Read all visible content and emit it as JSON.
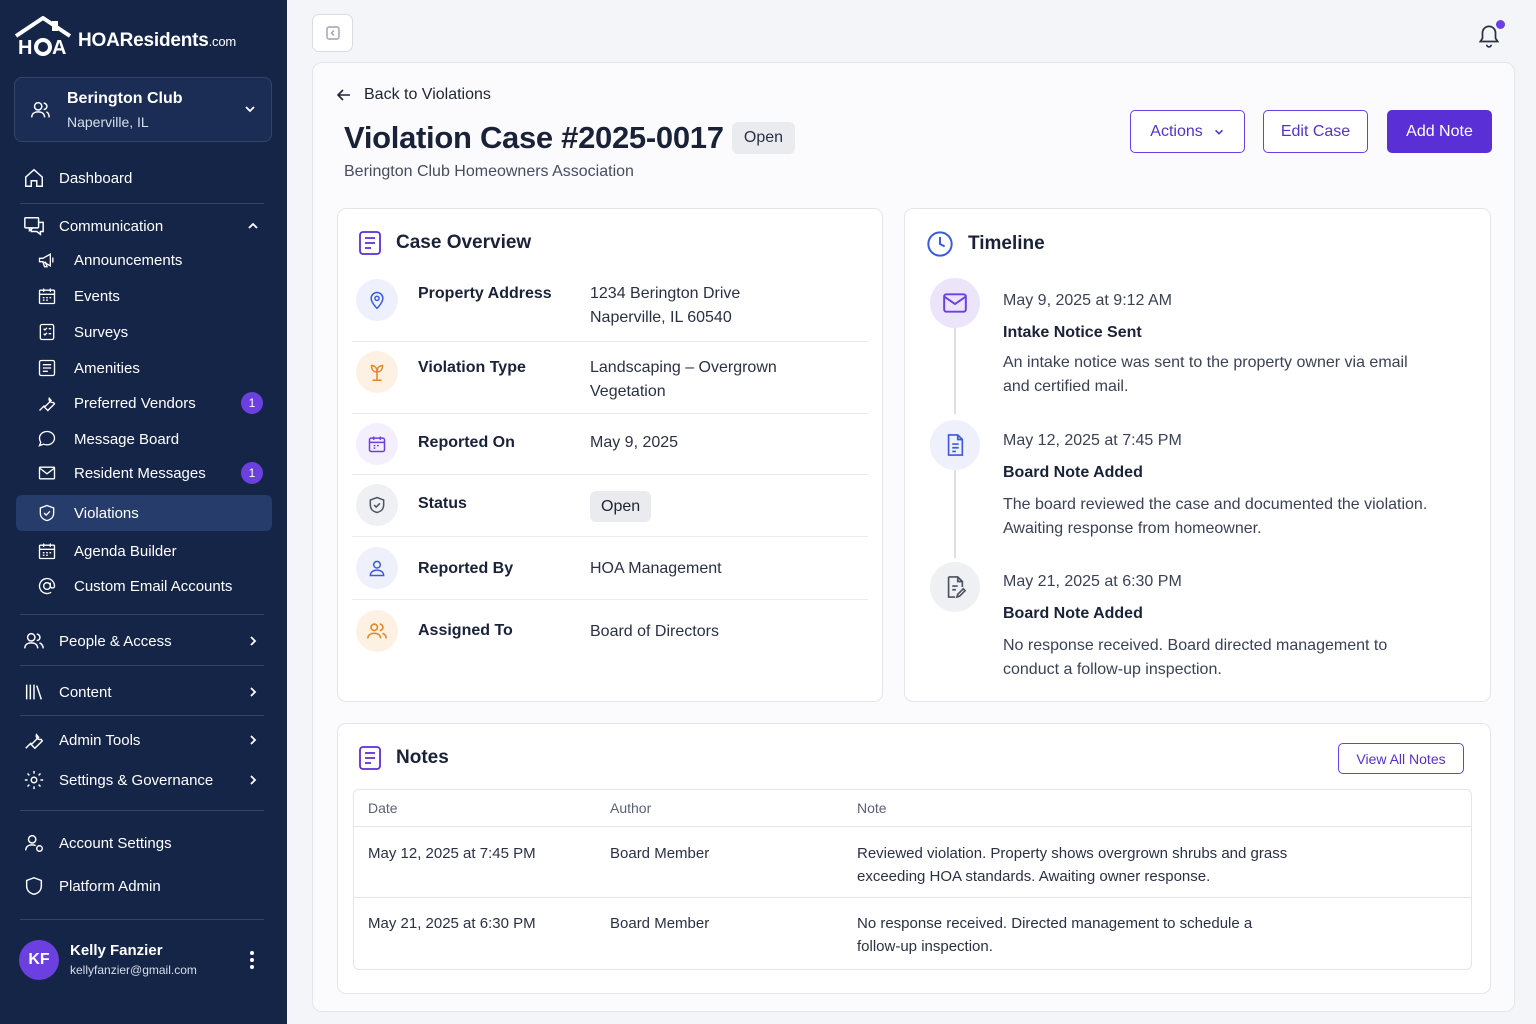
{
  "brand": {
    "name": "HOAResidents",
    "suffix": ".com"
  },
  "org": {
    "name": "Berington Club",
    "location": "Naperville, IL"
  },
  "nav": {
    "dashboard": "Dashboard",
    "communication": "Communication",
    "announcements": "Announcements",
    "events": "Events",
    "surveys": "Surveys",
    "amenities": "Amenities",
    "preferred_vendors": "Preferred Vendors",
    "preferred_vendors_badge": "1",
    "message_board": "Message Board",
    "resident_messages": "Resident Messages",
    "resident_messages_badge": "1",
    "violations": "Violations",
    "agenda_builder": "Agenda Builder",
    "custom_email": "Custom Email Accounts",
    "people_access": "People & Access",
    "content": "Content",
    "admin_tools": "Admin Tools",
    "settings_governance": "Settings & Governance",
    "account_settings": "Account Settings",
    "platform_admin": "Platform Admin"
  },
  "user": {
    "initials": "KF",
    "name": "Kelly Fanzier",
    "email": "kellyfanzier@gmail.com"
  },
  "page": {
    "back_label": "Back to Violations",
    "title": "Violation Case #2025-0017",
    "status_badge": "Open",
    "subtitle": "Berington Club Homeowners Association",
    "actions_label": "Actions",
    "edit_label": "Edit Case",
    "add_note_label": "Add Note"
  },
  "overview": {
    "heading": "Case Overview",
    "rows": [
      {
        "label": "Property Address",
        "value_line1": "1234 Berington Drive",
        "value_line2": "Naperville, IL 60540",
        "icon": "location-pin-icon"
      },
      {
        "label": "Violation Type",
        "value_line1": "Landscaping – Overgrown",
        "value_line2": "Vegetation",
        "icon": "plant-icon"
      },
      {
        "label": "Reported On",
        "value_line1": "May 9, 2025",
        "icon": "calendar-icon"
      },
      {
        "label": "Status",
        "value_line1": "Open",
        "icon": "shield-icon"
      },
      {
        "label": "Reported By",
        "value_line1": "HOA Management",
        "icon": "user-icon"
      },
      {
        "label": "Assigned To",
        "value_line1": "Board of Directors",
        "icon": "users-icon"
      }
    ]
  },
  "timeline": {
    "heading": "Timeline",
    "events": [
      {
        "date": "May 9, 2025 at 9:12 AM",
        "title": "Intake Notice Sent",
        "body": "An intake notice was sent to the property owner via email and certified mail.",
        "icon": "mail-icon"
      },
      {
        "date": "May 12, 2025 at 7:45 PM",
        "title": "Board Note Added",
        "body": "The board reviewed the case and documented the violation. Awaiting response from homeowner.",
        "icon": "document-icon"
      },
      {
        "date": "May 21, 2025 at 6:30 PM",
        "title": "Board Note Added",
        "body": "No response received. Board directed management to conduct a follow-up inspection.",
        "icon": "document-edit-icon"
      }
    ]
  },
  "notes": {
    "heading": "Notes",
    "view_all_label": "View All Notes",
    "columns": [
      "Date",
      "Author",
      "Note"
    ],
    "rows": [
      {
        "date": "May 12, 2025 at 7:45 PM",
        "author": "Board Member",
        "note": "Reviewed violation. Property shows overgrown shrubs and grass exceeding HOA standards. Awaiting owner response."
      },
      {
        "date": "May 21, 2025 at 6:30 PM",
        "author": "Board Member",
        "note": "No response received. Directed management to schedule a follow-up inspection."
      }
    ]
  },
  "colors": {
    "sidebar": "#152547",
    "accent": "#5b2fd6",
    "badge": "#6b3fe0"
  }
}
